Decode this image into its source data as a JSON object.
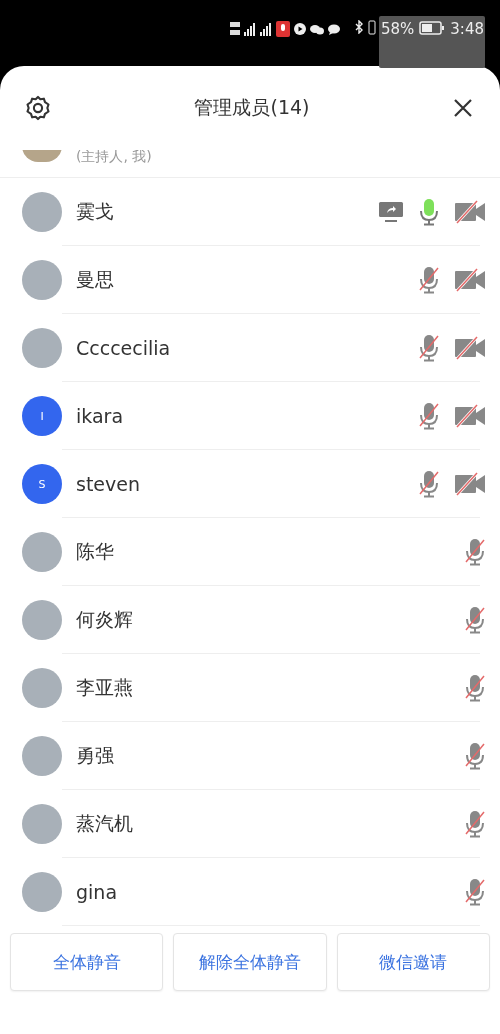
{
  "status_bar": {
    "battery": "58%",
    "time": "3:48"
  },
  "header": {
    "title": "管理成员(14)"
  },
  "host_row": {
    "subtitle": "(主持人, 我)"
  },
  "members": [
    {
      "name": "霙戈",
      "avatar": {
        "kind": "photo"
      },
      "sharing": true,
      "muted": false,
      "camera_on": false
    },
    {
      "name": "曼思",
      "avatar": {
        "kind": "photo"
      },
      "muted": true,
      "camera_on": false
    },
    {
      "name": "Ccccecilia",
      "avatar": {
        "kind": "photo"
      },
      "muted": true,
      "camera_on": false
    },
    {
      "name": "ikara",
      "avatar": {
        "kind": "letter",
        "letter": "I"
      },
      "muted": true,
      "camera_on": false
    },
    {
      "name": "steven",
      "avatar": {
        "kind": "letter",
        "letter": "S"
      },
      "muted": true,
      "camera_on": false
    },
    {
      "name": "陈华",
      "avatar": {
        "kind": "photo"
      },
      "muted": true
    },
    {
      "name": "何炎辉",
      "avatar": {
        "kind": "photo"
      },
      "muted": true
    },
    {
      "name": "李亚燕",
      "avatar": {
        "kind": "photo"
      },
      "muted": true
    },
    {
      "name": "勇强",
      "avatar": {
        "kind": "photo"
      },
      "muted": true
    },
    {
      "name": "蒸汽机",
      "avatar": {
        "kind": "photo"
      },
      "muted": true
    },
    {
      "name": "gina",
      "avatar": {
        "kind": "photo"
      },
      "muted": true
    }
  ],
  "buttons": [
    "全体静音",
    "解除全体静音",
    "微信邀请"
  ]
}
